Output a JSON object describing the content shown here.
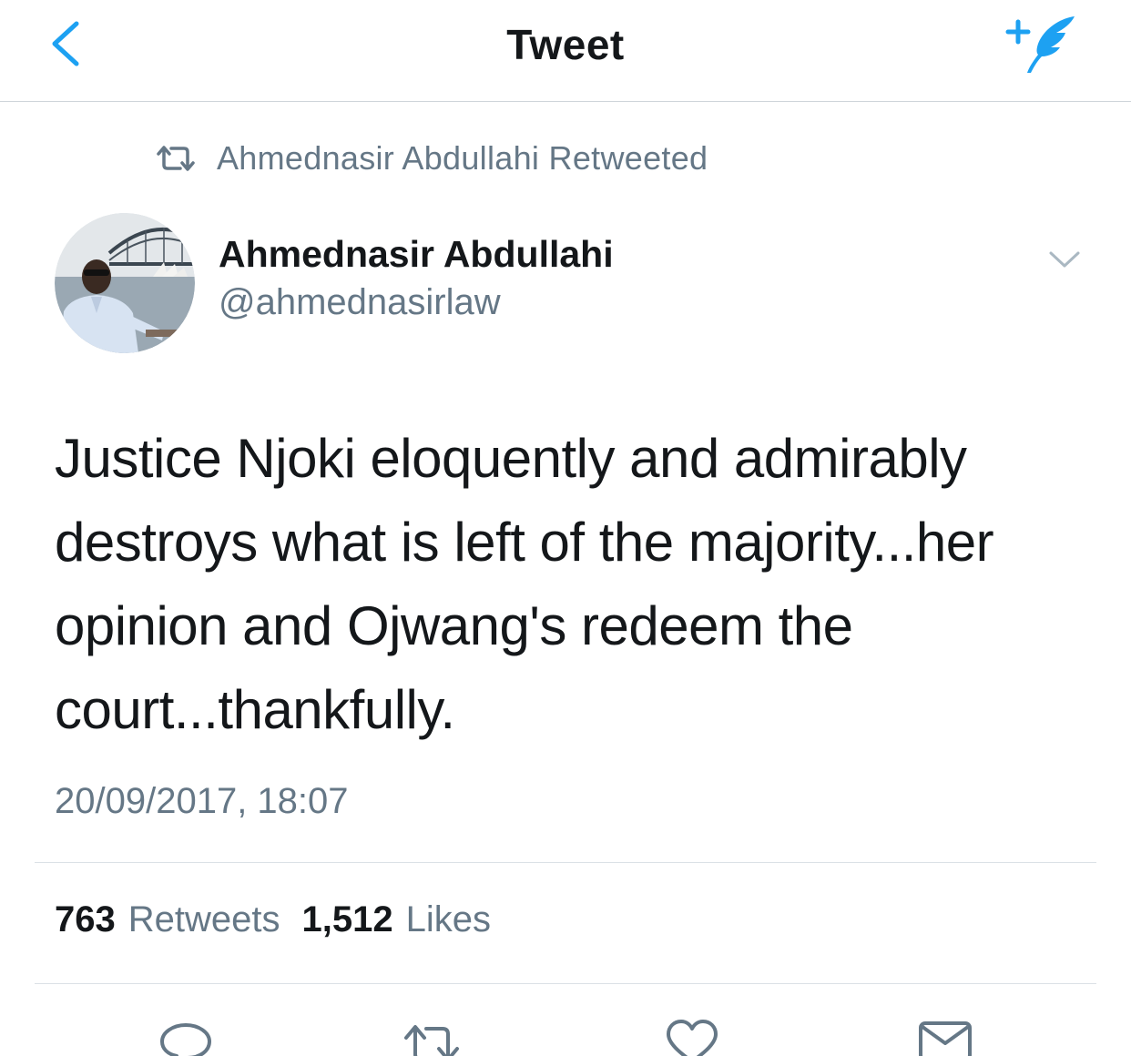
{
  "navbar": {
    "title": "Tweet",
    "back_icon": "chevron-left-icon",
    "compose_icon": "compose-tweet-icon"
  },
  "retweet_context": {
    "label": "Ahmednasir Abdullahi Retweeted",
    "icon": "retweet-icon"
  },
  "author": {
    "name": "Ahmednasir Abdullahi",
    "handle": "@ahmednasirlaw"
  },
  "tweet": {
    "lines": [
      "Justice Njoki eloquently and admirably",
      "destroys what is left of the majority...her",
      "opinion and Ojwang's redeem the",
      "court...thankfully."
    ],
    "timestamp": "20/09/2017, 18:07"
  },
  "stats": {
    "retweets_count": "763",
    "retweets_label": "Retweets",
    "likes_count": "1,512",
    "likes_label": "Likes"
  },
  "actions": [
    "reply-icon",
    "retweet-icon",
    "like-icon",
    "direct-message-icon"
  ],
  "colors": {
    "accent": "#1DA1F2",
    "text_primary": "#14171A",
    "text_secondary": "#657786",
    "divider": "#DBE1E6"
  }
}
